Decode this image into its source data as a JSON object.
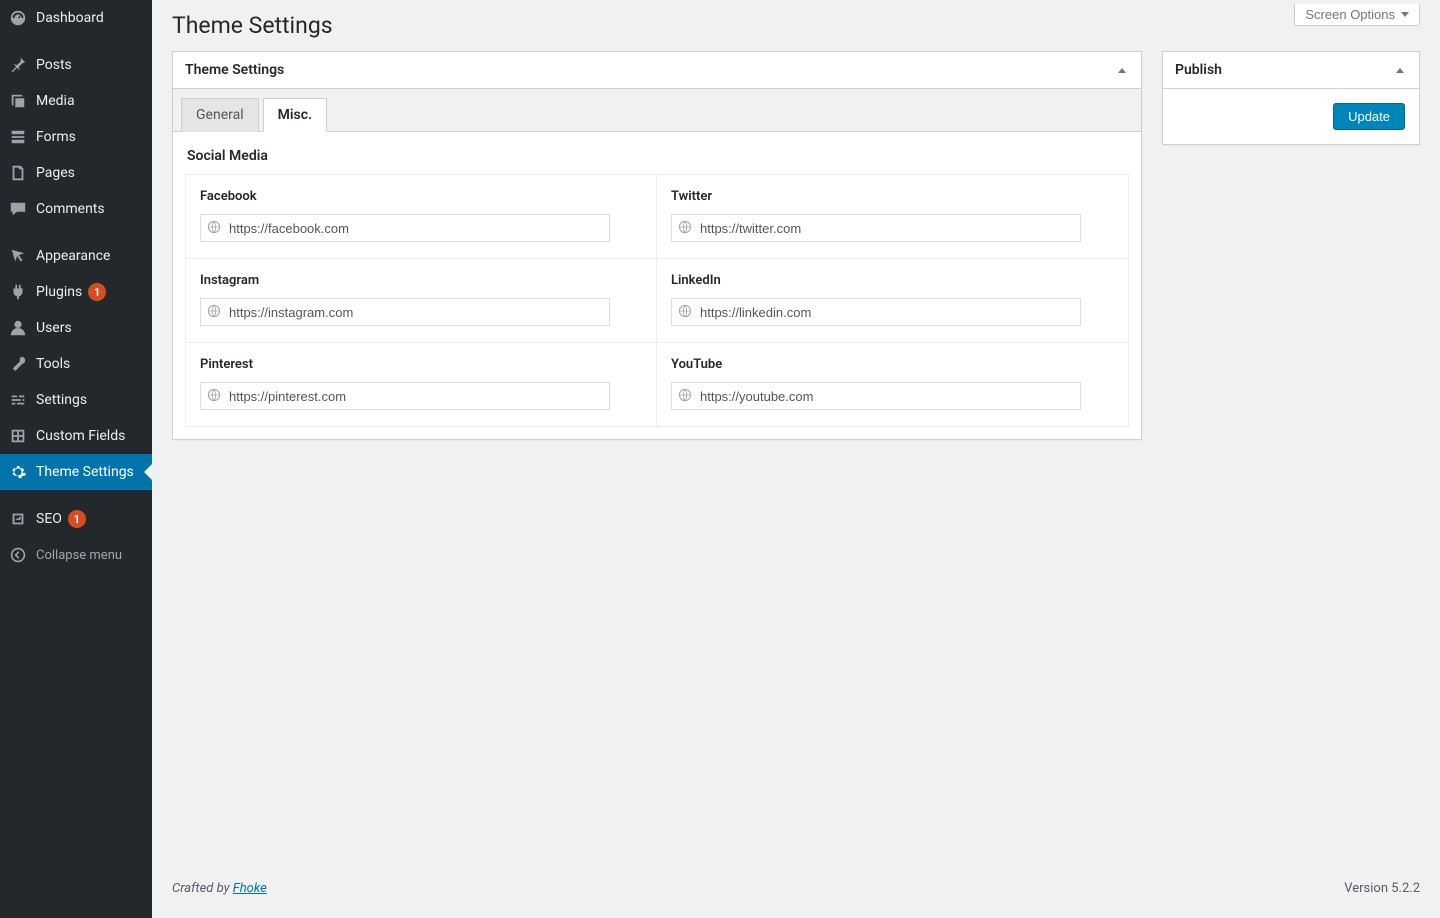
{
  "screen_options": {
    "label": "Screen Options"
  },
  "page": {
    "title": "Theme Settings"
  },
  "sidebar": {
    "items": [
      {
        "label": "Dashboard",
        "icon": "dashboard-icon"
      },
      {
        "label": "Posts",
        "icon": "pin-icon"
      },
      {
        "label": "Media",
        "icon": "media-icon"
      },
      {
        "label": "Forms",
        "icon": "forms-icon"
      },
      {
        "label": "Pages",
        "icon": "pages-icon"
      },
      {
        "label": "Comments",
        "icon": "comments-icon"
      },
      {
        "label": "Appearance",
        "icon": "appearance-icon"
      },
      {
        "label": "Plugins",
        "icon": "plugins-icon",
        "badge": "1"
      },
      {
        "label": "Users",
        "icon": "users-icon"
      },
      {
        "label": "Tools",
        "icon": "tools-icon"
      },
      {
        "label": "Settings",
        "icon": "settings-icon"
      },
      {
        "label": "Custom Fields",
        "icon": "custom-fields-icon"
      },
      {
        "label": "Theme Settings",
        "icon": "gear-icon",
        "current": true
      },
      {
        "label": "SEO",
        "icon": "seo-icon",
        "badge": "1"
      }
    ],
    "collapse": {
      "label": "Collapse menu"
    }
  },
  "main_box": {
    "title": "Theme Settings",
    "tabs": [
      {
        "label": "General"
      },
      {
        "label": "Misc.",
        "active": true
      }
    ],
    "section_heading": "Social Media",
    "fields": [
      {
        "label": "Facebook",
        "value": "https://facebook.com"
      },
      {
        "label": "Twitter",
        "value": "https://twitter.com"
      },
      {
        "label": "Instagram",
        "value": "https://instagram.com"
      },
      {
        "label": "LinkedIn",
        "value": "https://linkedin.com"
      },
      {
        "label": "Pinterest",
        "value": "https://pinterest.com"
      },
      {
        "label": "YouTube",
        "value": "https://youtube.com"
      }
    ]
  },
  "publish_box": {
    "title": "Publish",
    "button": "Update"
  },
  "footer": {
    "credit_prefix": "Crafted by ",
    "credit_link": "Fhoke",
    "version": "Version 5.2.2"
  }
}
